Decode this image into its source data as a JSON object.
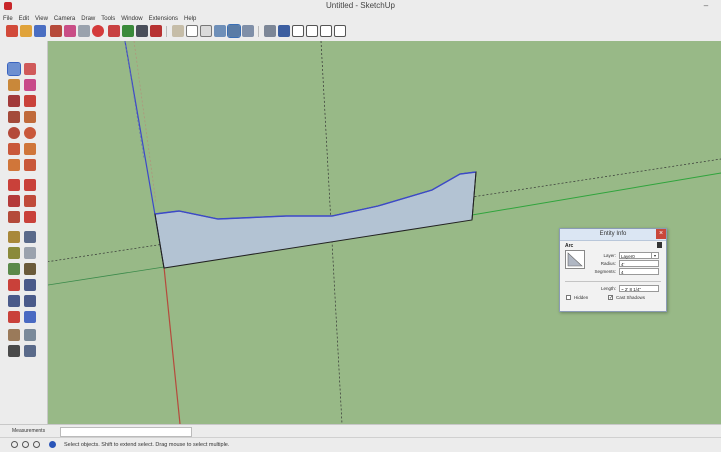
{
  "window": {
    "title": "Untitled - SketchUp",
    "minimize": "–"
  },
  "menu": [
    "File",
    "Edit",
    "View",
    "Camera",
    "Draw",
    "Tools",
    "Window",
    "Extensions",
    "Help"
  ],
  "entity_info": {
    "title": "Entity Info",
    "close": "×",
    "type": "Arc",
    "layer_label": "Layer:",
    "layer_value": "Layer0",
    "radius_label": "Radius:",
    "radius_value": "4'",
    "segments_label": "Segments:",
    "segments_value": "4",
    "length_label": "Length:",
    "length_value": "~ 2' 8 1/4\"",
    "hidden_label": "Hidden",
    "hidden_checked": false,
    "cast_shadows_label": "Cast Shadows",
    "cast_shadows_checked": true,
    "check_mark": "✓"
  },
  "measurements": {
    "label": "Measurements"
  },
  "status": {
    "message": "Select objects. Shift to extend select. Drag mouse to select multiple."
  },
  "colors": {
    "viewport": "#98b987",
    "shape_fill": "#b3c3d3",
    "blue_axis": "#3c49c9",
    "red_axis": "#b54a3c",
    "green_axis": "#2fa43c"
  }
}
